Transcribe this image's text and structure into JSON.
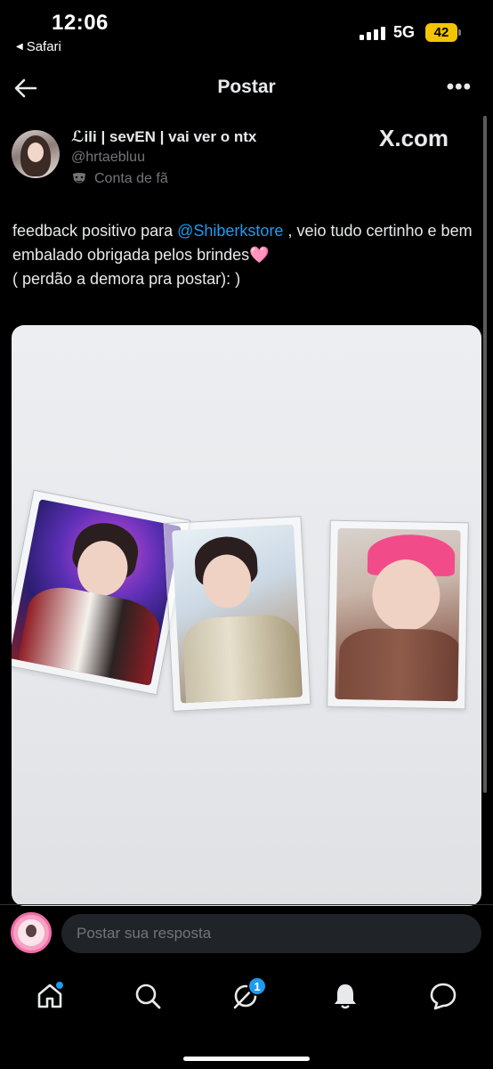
{
  "status_bar": {
    "time": "12:06",
    "back_app": "Safari",
    "network": "5G",
    "battery": "42"
  },
  "header": {
    "title": "Postar",
    "more": "•••"
  },
  "author": {
    "name": "ℒili | sevEN | vai ver o ntx",
    "handle": "@hrtaebluu",
    "badge_label": "Conta de fã",
    "source": "X.com"
  },
  "tweet": {
    "text_part1": "feedback positivo para ",
    "mention": "@Shiberkstore",
    "text_part2": " , veio tudo certinho e bem embalado obrigada pelos brindes",
    "emoji": "🩷",
    "text_part3": "( perdão a demora pra postar):   )"
  },
  "reply": {
    "placeholder": "Postar sua resposta"
  },
  "nav": {
    "items": [
      "home",
      "search",
      "grok",
      "notifications",
      "messages"
    ],
    "grok_badge": "1"
  },
  "colors": {
    "background": "#000000",
    "accent": "#1d9bf0",
    "secondary_text": "#71767b"
  }
}
